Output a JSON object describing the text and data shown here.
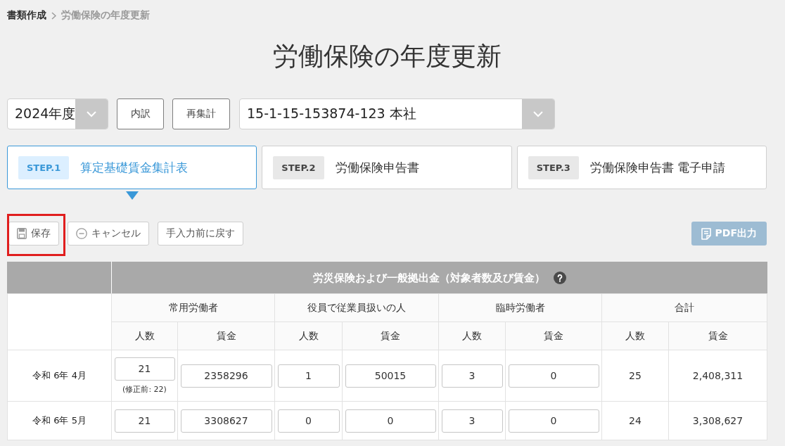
{
  "breadcrumb": [
    {
      "label": "書類作成"
    },
    {
      "label": "労働保険の年度更新"
    }
  ],
  "title": "労働保険の年度更新",
  "controls": {
    "year_select": {
      "value": "2024年度"
    },
    "buttons": [
      {
        "label": "内訳"
      },
      {
        "label": "再集計"
      }
    ],
    "office_select": {
      "value": "15-1-15-153874-123 本社"
    }
  },
  "steps": [
    {
      "badge": "STEP.1",
      "label": "算定基礎賃金集計表",
      "selected": true
    },
    {
      "badge": "STEP.2",
      "label": "労働保険申告書",
      "selected": false
    },
    {
      "badge": "STEP.3",
      "label": "労働保険申告書 電子申請",
      "selected": false
    }
  ],
  "toolbar": {
    "buttons": [
      {
        "kind": "save",
        "label": "保存",
        "highlighted": true
      },
      {
        "kind": "cancel",
        "label": "キャンセル",
        "highlighted": false
      },
      {
        "kind": "revert",
        "label": "手入力前に戻す",
        "highlighted": false
      }
    ],
    "export_button": {
      "label": "PDF出力",
      "disabled": true
    }
  },
  "table": {
    "title": "労災保険および一般拠出金（対象者数及び賃金）",
    "groups": [
      "常用労働者",
      "役員で従業員扱いの人",
      "臨時労働者",
      "合計"
    ],
    "columns": [
      "人数",
      "賃金",
      "人数",
      "賃金",
      "人数",
      "賃金",
      "人数",
      "賃金"
    ],
    "rows": [
      {
        "month": "令和 6年 4月",
        "cells": [
          {
            "kind": "input",
            "value": "21",
            "note": "(修正前: 22)"
          },
          {
            "kind": "input",
            "value": "2358296"
          },
          {
            "kind": "input",
            "value": "1"
          },
          {
            "kind": "input",
            "value": "50015"
          },
          {
            "kind": "input",
            "value": "3"
          },
          {
            "kind": "input",
            "value": "0"
          },
          {
            "kind": "text",
            "value": "25"
          },
          {
            "kind": "text",
            "value": "2,408,311"
          }
        ]
      },
      {
        "month": "令和 6年 5月",
        "cells": [
          {
            "kind": "input",
            "value": "21"
          },
          {
            "kind": "input",
            "value": "3308627"
          },
          {
            "kind": "input",
            "value": "0"
          },
          {
            "kind": "input",
            "value": "0"
          },
          {
            "kind": "input",
            "value": "3"
          },
          {
            "kind": "input",
            "value": "0"
          },
          {
            "kind": "text",
            "value": "24"
          },
          {
            "kind": "text",
            "value": "3,308,627"
          }
        ]
      }
    ]
  }
}
